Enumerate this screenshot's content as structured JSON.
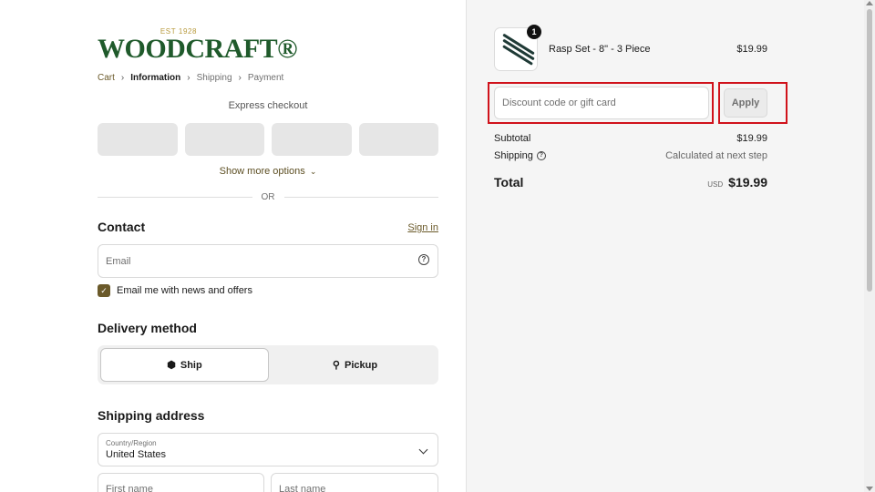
{
  "logo": {
    "est": "EST 1928",
    "brand": "WOODCRAFT®"
  },
  "breadcrumb": {
    "cart": "Cart",
    "information": "Information",
    "shipping": "Shipping",
    "payment": "Payment"
  },
  "express": {
    "title": "Express checkout",
    "show_more": "Show more options",
    "or": "OR"
  },
  "contact": {
    "title": "Contact",
    "sign_in": "Sign in",
    "email_placeholder": "Email",
    "newsletter_label": "Email me with news and offers",
    "newsletter_checked": true
  },
  "delivery": {
    "title": "Delivery method",
    "ship": "Ship",
    "pickup": "Pickup",
    "selected": "Ship"
  },
  "shipping_address": {
    "title": "Shipping address",
    "country_label": "Country/Region",
    "country_value": "United States",
    "first_name_placeholder": "First name",
    "last_name_placeholder": "Last name"
  },
  "summary": {
    "item": {
      "name": "Rasp Set - 8\" - 3 Piece",
      "price": "$19.99",
      "qty": "1"
    },
    "discount_placeholder": "Discount code or gift card",
    "apply": "Apply",
    "subtotal_label": "Subtotal",
    "subtotal_value": "$19.99",
    "shipping_label": "Shipping",
    "shipping_value": "Calculated at next step",
    "total_label": "Total",
    "currency": "USD",
    "total_value": "$19.99"
  },
  "colors": {
    "brand_green": "#1f5a2b",
    "accent_gold": "#6b5a2a",
    "highlight_red": "#d0121b"
  }
}
